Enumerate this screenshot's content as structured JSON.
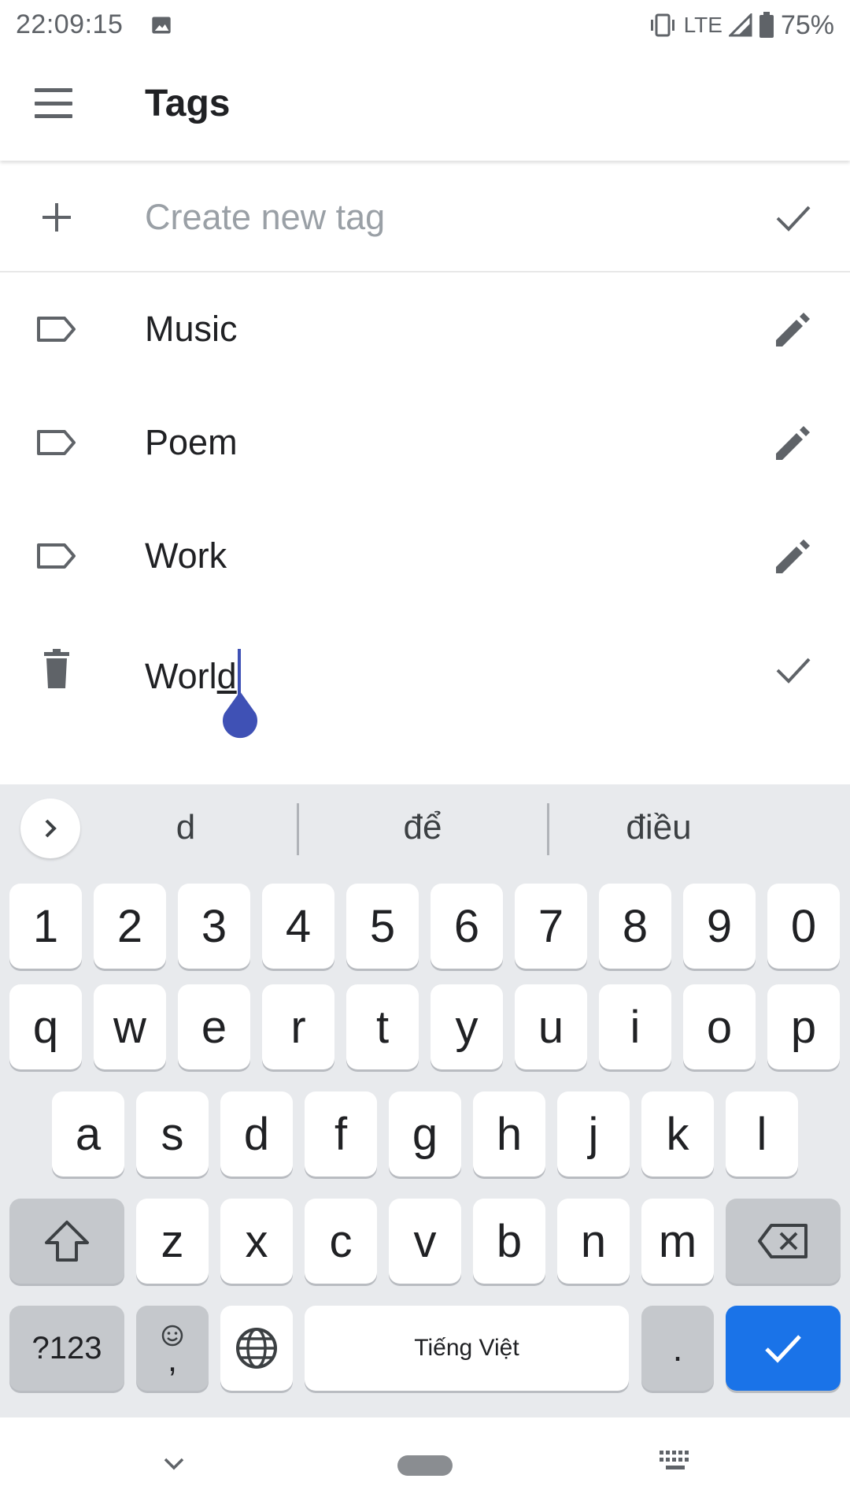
{
  "status_bar": {
    "time": "22:09:15",
    "network": "LTE",
    "battery": "75%"
  },
  "app_bar": {
    "title": "Tags",
    "menu_icon": "hamburger-menu-icon"
  },
  "create_row": {
    "placeholder": "Create new tag",
    "leading_icon": "plus-icon",
    "trailing_icon": "check-icon"
  },
  "tags": [
    {
      "label": "Music",
      "leading_icon": "tag-outline-icon",
      "trailing_icon": "edit-pencil-icon"
    },
    {
      "label": "Poem",
      "leading_icon": "tag-outline-icon",
      "trailing_icon": "edit-pencil-icon"
    },
    {
      "label": "Work",
      "leading_icon": "tag-outline-icon",
      "trailing_icon": "edit-pencil-icon"
    }
  ],
  "editing_row": {
    "value_prefix": "Worl",
    "value_underlined": "d",
    "leading_icon": "trash-icon",
    "trailing_icon": "check-icon"
  },
  "keyboard": {
    "suggestions": [
      "d",
      "để",
      "điều"
    ],
    "number_row": [
      "1",
      "2",
      "3",
      "4",
      "5",
      "6",
      "7",
      "8",
      "9",
      "0"
    ],
    "row1": [
      "q",
      "w",
      "e",
      "r",
      "t",
      "y",
      "u",
      "i",
      "o",
      "p"
    ],
    "row2": [
      "a",
      "s",
      "d",
      "f",
      "g",
      "h",
      "j",
      "k",
      "l"
    ],
    "row3": [
      "z",
      "x",
      "c",
      "v",
      "b",
      "n",
      "m"
    ],
    "symbols_key": "?123",
    "comma_key": ",",
    "space_label": "Tiếng Việt",
    "period_key": ".",
    "accent_color": "#1a73e8"
  }
}
